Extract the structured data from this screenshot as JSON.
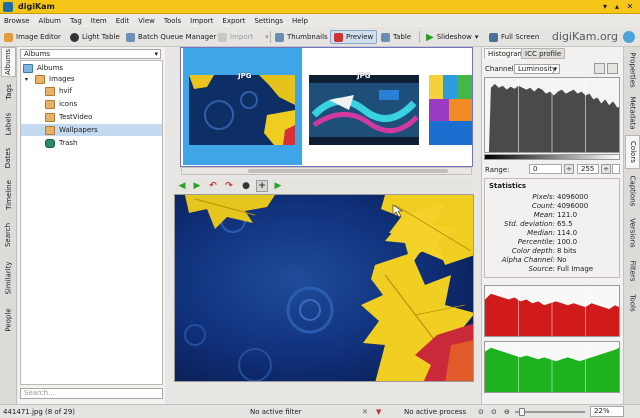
{
  "window": {
    "title": "digiKam"
  },
  "menu": [
    "Browse",
    "Album",
    "Tag",
    "Item",
    "Edit",
    "View",
    "Tools",
    "Import",
    "Export",
    "Settings",
    "Help"
  ],
  "toolbar": {
    "image_editor": "Image Editor",
    "light_table": "Light Table",
    "batch_queue": "Batch Queue Manager",
    "import": "Import",
    "thumbnails": "Thumbnails",
    "preview": "Preview",
    "table": "Table",
    "slideshow": "Slideshow",
    "full_screen": "Full Screen",
    "brand": "digiKam.org"
  },
  "left_tabs": [
    "Albums",
    "Tags",
    "Labels",
    "Dates",
    "Timeline",
    "Search",
    "Similarity",
    "People"
  ],
  "albums_panel": {
    "selector": "Albums",
    "tree": {
      "root": "Albums",
      "images": "Images",
      "children": [
        "hvif",
        "icons",
        "TestVideo",
        "Wallpapers",
        "Trash"
      ]
    },
    "search_placeholder": "Search..."
  },
  "thumbnails": [
    {
      "badge": "JPG"
    },
    {
      "badge": "JPG"
    },
    {
      "badge": ""
    }
  ],
  "right_tabs": [
    "Properties",
    "Metadata",
    "Colors",
    "Captions",
    "Versions",
    "Filters",
    "Tools"
  ],
  "colors_panel": {
    "tabs": [
      "Histogram",
      "ICC profile"
    ],
    "channel_label": "Channel:",
    "channel_value": "Luminosity",
    "range_label": "Range:",
    "range_min": "0",
    "range_max": "255",
    "range_extra": "",
    "statistics_title": "Statistics",
    "stats": [
      {
        "k": "Pixels:",
        "v": "4096000"
      },
      {
        "k": "Count:",
        "v": "4096000"
      },
      {
        "k": "Mean:",
        "v": "121.0"
      },
      {
        "k": "Std. deviation:",
        "v": "65.5"
      },
      {
        "k": "Median:",
        "v": "114.0"
      },
      {
        "k": "Percentile:",
        "v": "100.0"
      },
      {
        "k": "Color depth:",
        "v": "8 bits"
      },
      {
        "k": "Alpha Channel:",
        "v": "No"
      },
      {
        "k": "Source:",
        "v": "Full Image"
      }
    ]
  },
  "statusbar": {
    "file": "441471.jpg (8 of 29)",
    "filter": "No active filter",
    "process": "No active process",
    "zoom": "22%"
  },
  "colors": {
    "title_bar": "#f5c518",
    "selection": "#3ea6e6",
    "histogram_red": "#d11a1a",
    "histogram_green": "#1eb31e"
  }
}
